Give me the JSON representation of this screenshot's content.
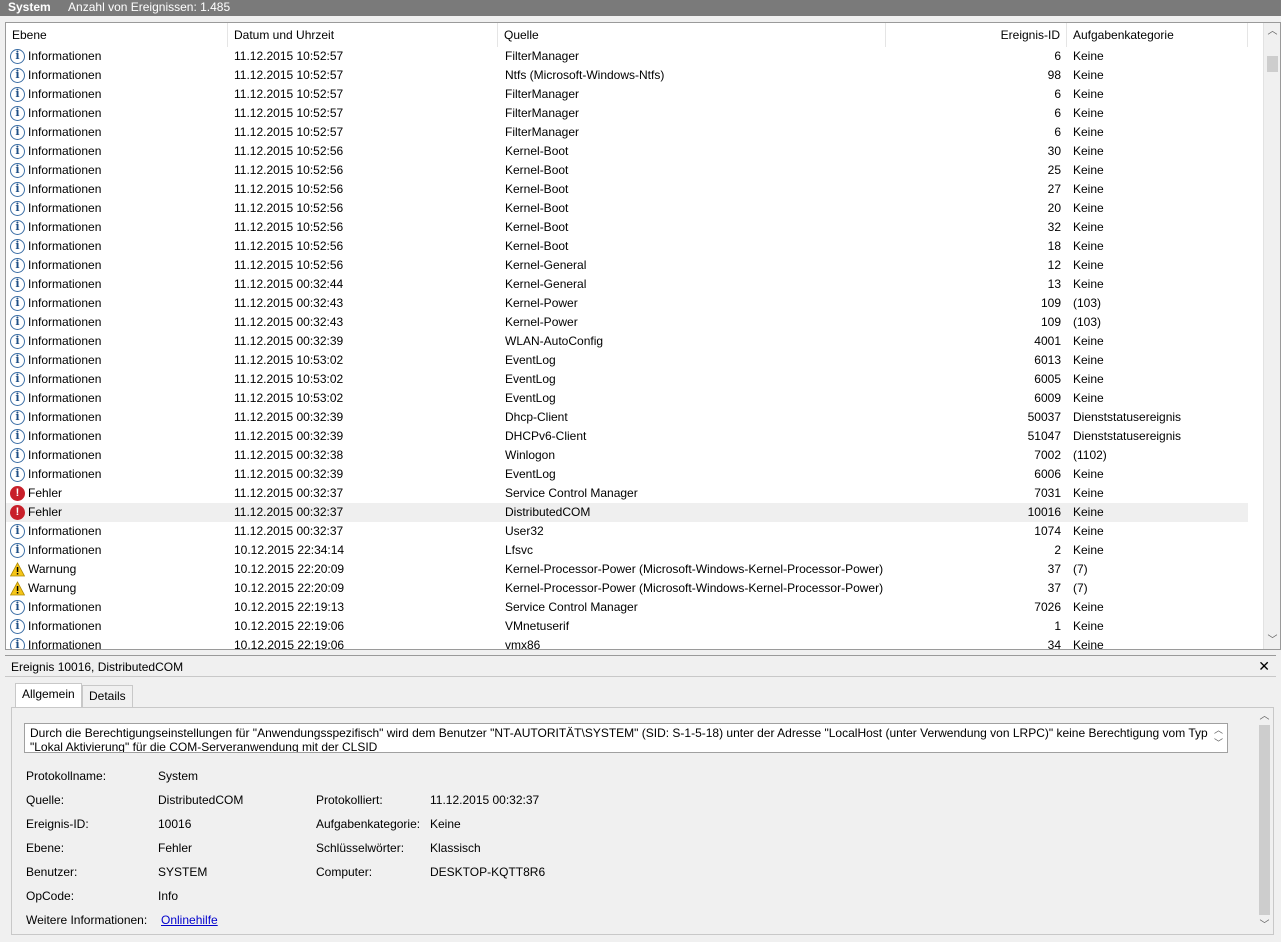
{
  "titlebar": {
    "log_name": "System",
    "event_count": "Anzahl von Ereignissen: 1.485"
  },
  "columns": {
    "level": "Ebene",
    "datetime": "Datum und Uhrzeit",
    "source": "Quelle",
    "event_id": "Ereignis-ID",
    "category": "Aufgabenkategorie"
  },
  "events": [
    {
      "level": "Informationen",
      "icon": "info",
      "datetime": "11.12.2015 10:52:57",
      "source": "FilterManager",
      "id": "6",
      "category": "Keine"
    },
    {
      "level": "Informationen",
      "icon": "info",
      "datetime": "11.12.2015 10:52:57",
      "source": "Ntfs (Microsoft-Windows-Ntfs)",
      "id": "98",
      "category": "Keine"
    },
    {
      "level": "Informationen",
      "icon": "info",
      "datetime": "11.12.2015 10:52:57",
      "source": "FilterManager",
      "id": "6",
      "category": "Keine"
    },
    {
      "level": "Informationen",
      "icon": "info",
      "datetime": "11.12.2015 10:52:57",
      "source": "FilterManager",
      "id": "6",
      "category": "Keine"
    },
    {
      "level": "Informationen",
      "icon": "info",
      "datetime": "11.12.2015 10:52:57",
      "source": "FilterManager",
      "id": "6",
      "category": "Keine"
    },
    {
      "level": "Informationen",
      "icon": "info",
      "datetime": "11.12.2015 10:52:56",
      "source": "Kernel-Boot",
      "id": "30",
      "category": "Keine"
    },
    {
      "level": "Informationen",
      "icon": "info",
      "datetime": "11.12.2015 10:52:56",
      "source": "Kernel-Boot",
      "id": "25",
      "category": "Keine"
    },
    {
      "level": "Informationen",
      "icon": "info",
      "datetime": "11.12.2015 10:52:56",
      "source": "Kernel-Boot",
      "id": "27",
      "category": "Keine"
    },
    {
      "level": "Informationen",
      "icon": "info",
      "datetime": "11.12.2015 10:52:56",
      "source": "Kernel-Boot",
      "id": "20",
      "category": "Keine"
    },
    {
      "level": "Informationen",
      "icon": "info",
      "datetime": "11.12.2015 10:52:56",
      "source": "Kernel-Boot",
      "id": "32",
      "category": "Keine"
    },
    {
      "level": "Informationen",
      "icon": "info",
      "datetime": "11.12.2015 10:52:56",
      "source": "Kernel-Boot",
      "id": "18",
      "category": "Keine"
    },
    {
      "level": "Informationen",
      "icon": "info",
      "datetime": "11.12.2015 10:52:56",
      "source": "Kernel-General",
      "id": "12",
      "category": "Keine"
    },
    {
      "level": "Informationen",
      "icon": "info",
      "datetime": "11.12.2015 00:32:44",
      "source": "Kernel-General",
      "id": "13",
      "category": "Keine"
    },
    {
      "level": "Informationen",
      "icon": "info",
      "datetime": "11.12.2015 00:32:43",
      "source": "Kernel-Power",
      "id": "109",
      "category": "(103)"
    },
    {
      "level": "Informationen",
      "icon": "info",
      "datetime": "11.12.2015 00:32:43",
      "source": "Kernel-Power",
      "id": "109",
      "category": "(103)"
    },
    {
      "level": "Informationen",
      "icon": "info",
      "datetime": "11.12.2015 00:32:39",
      "source": "WLAN-AutoConfig",
      "id": "4001",
      "category": "Keine"
    },
    {
      "level": "Informationen",
      "icon": "info",
      "datetime": "11.12.2015 10:53:02",
      "source": "EventLog",
      "id": "6013",
      "category": "Keine"
    },
    {
      "level": "Informationen",
      "icon": "info",
      "datetime": "11.12.2015 10:53:02",
      "source": "EventLog",
      "id": "6005",
      "category": "Keine"
    },
    {
      "level": "Informationen",
      "icon": "info",
      "datetime": "11.12.2015 10:53:02",
      "source": "EventLog",
      "id": "6009",
      "category": "Keine"
    },
    {
      "level": "Informationen",
      "icon": "info",
      "datetime": "11.12.2015 00:32:39",
      "source": "Dhcp-Client",
      "id": "50037",
      "category": "Dienststatusereignis"
    },
    {
      "level": "Informationen",
      "icon": "info",
      "datetime": "11.12.2015 00:32:39",
      "source": "DHCPv6-Client",
      "id": "51047",
      "category": "Dienststatusereignis"
    },
    {
      "level": "Informationen",
      "icon": "info",
      "datetime": "11.12.2015 00:32:38",
      "source": "Winlogon",
      "id": "7002",
      "category": "(1102)"
    },
    {
      "level": "Informationen",
      "icon": "info",
      "datetime": "11.12.2015 00:32:39",
      "source": "EventLog",
      "id": "6006",
      "category": "Keine"
    },
    {
      "level": "Fehler",
      "icon": "error",
      "datetime": "11.12.2015 00:32:37",
      "source": "Service Control Manager",
      "id": "7031",
      "category": "Keine"
    },
    {
      "level": "Fehler",
      "icon": "error",
      "datetime": "11.12.2015 00:32:37",
      "source": "DistributedCOM",
      "id": "10016",
      "category": "Keine",
      "selected": true
    },
    {
      "level": "Informationen",
      "icon": "info",
      "datetime": "11.12.2015 00:32:37",
      "source": "User32",
      "id": "1074",
      "category": "Keine"
    },
    {
      "level": "Informationen",
      "icon": "info",
      "datetime": "10.12.2015 22:34:14",
      "source": "Lfsvc",
      "id": "2",
      "category": "Keine"
    },
    {
      "level": "Warnung",
      "icon": "warning",
      "datetime": "10.12.2015 22:20:09",
      "source": "Kernel-Processor-Power (Microsoft-Windows-Kernel-Processor-Power)",
      "id": "37",
      "category": "(7)"
    },
    {
      "level": "Warnung",
      "icon": "warning",
      "datetime": "10.12.2015 22:20:09",
      "source": "Kernel-Processor-Power (Microsoft-Windows-Kernel-Processor-Power)",
      "id": "37",
      "category": "(7)"
    },
    {
      "level": "Informationen",
      "icon": "info",
      "datetime": "10.12.2015 22:19:13",
      "source": "Service Control Manager",
      "id": "7026",
      "category": "Keine"
    },
    {
      "level": "Informationen",
      "icon": "info",
      "datetime": "10.12.2015 22:19:06",
      "source": "VMnetuserif",
      "id": "1",
      "category": "Keine"
    },
    {
      "level": "Informationen",
      "icon": "info",
      "datetime": "10.12.2015 22:19:06",
      "source": "vmx86",
      "id": "34",
      "category": "Keine"
    }
  ],
  "detail": {
    "title": "Ereignis 10016, DistributedCOM",
    "close_glyph": "✕",
    "tabs": {
      "general": "Allgemein",
      "details": "Details"
    },
    "message_line1": "Durch die Berechtigungseinstellungen für \"Anwendungsspezifisch\" wird dem Benutzer \"NT-AUTORITÄT\\SYSTEM\" (SID: S-1-5-18) unter der Adresse \"LocalHost (unter Verwendung von LRPC)\" keine Berechtigung vom Typ",
    "message_line2": "\"Lokal Aktivierung\" für die COM-Serveranwendung mit der CLSID",
    "labels": {
      "log_name": "Protokollname:",
      "source": "Quelle:",
      "event_id": "Ereignis-ID:",
      "level": "Ebene:",
      "user": "Benutzer:",
      "opcode": "OpCode:",
      "more_info": "Weitere Informationen:",
      "logged": "Protokolliert:",
      "category": "Aufgabenkategorie:",
      "keywords": "Schlüsselwörter:",
      "computer": "Computer:"
    },
    "values": {
      "log_name": "System",
      "source": "DistributedCOM",
      "event_id": "10016",
      "level": "Fehler",
      "user": "SYSTEM",
      "opcode": "Info",
      "more_info_link": "Onlinehilfe",
      "logged": "11.12.2015 00:32:37",
      "category": "Keine",
      "keywords": "Klassisch",
      "computer": "DESKTOP-KQTT8R6"
    }
  }
}
